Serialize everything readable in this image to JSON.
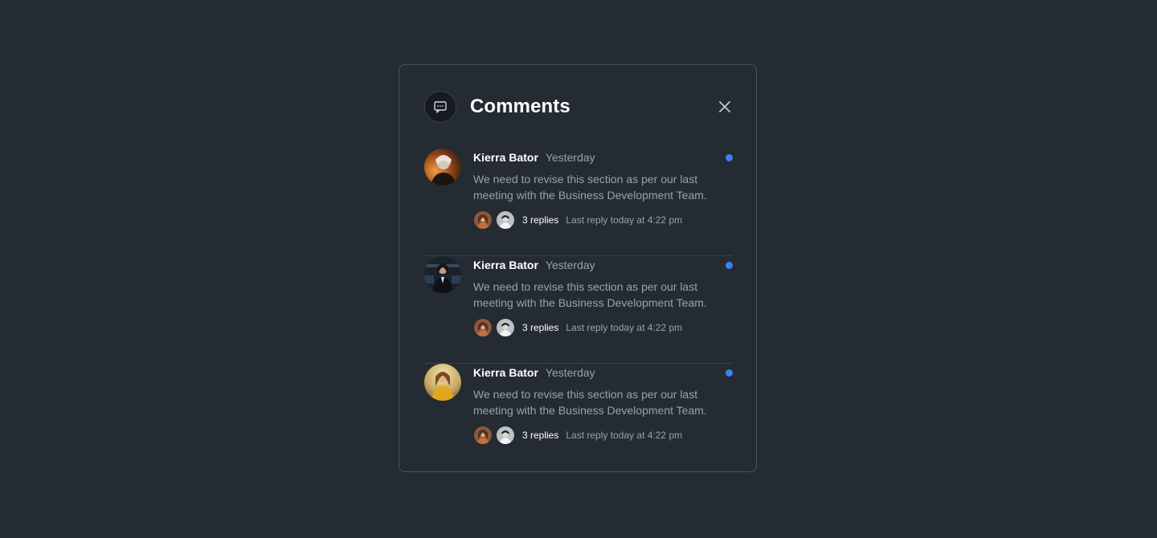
{
  "panel": {
    "title": "Comments",
    "header_icon": "message-square-icon",
    "close_icon": "close-icon"
  },
  "colors": {
    "background": "#252b33",
    "unread_dot": "#3b82f6",
    "muted_text": "#9aa1ab"
  },
  "comments": [
    {
      "author": "Kierra Bator",
      "time": "Yesterday",
      "text": "We need to revise this section as per our last meeting with the Business Development Team.",
      "replies_label": "3 replies",
      "last_reply": "Last reply today at 4:22 pm",
      "unread": true
    },
    {
      "author": "Kierra Bator",
      "time": "Yesterday",
      "text": "We need to revise this section as per our last meeting with the Business Development Team.",
      "replies_label": "3 replies",
      "last_reply": "Last reply today at 4:22 pm",
      "unread": true
    },
    {
      "author": "Kierra Bator",
      "time": "Yesterday",
      "text": "We need to revise this section as per our last meeting with the Business Development Team.",
      "replies_label": "3 replies",
      "last_reply": "Last reply today at 4:22 pm",
      "unread": true
    }
  ]
}
